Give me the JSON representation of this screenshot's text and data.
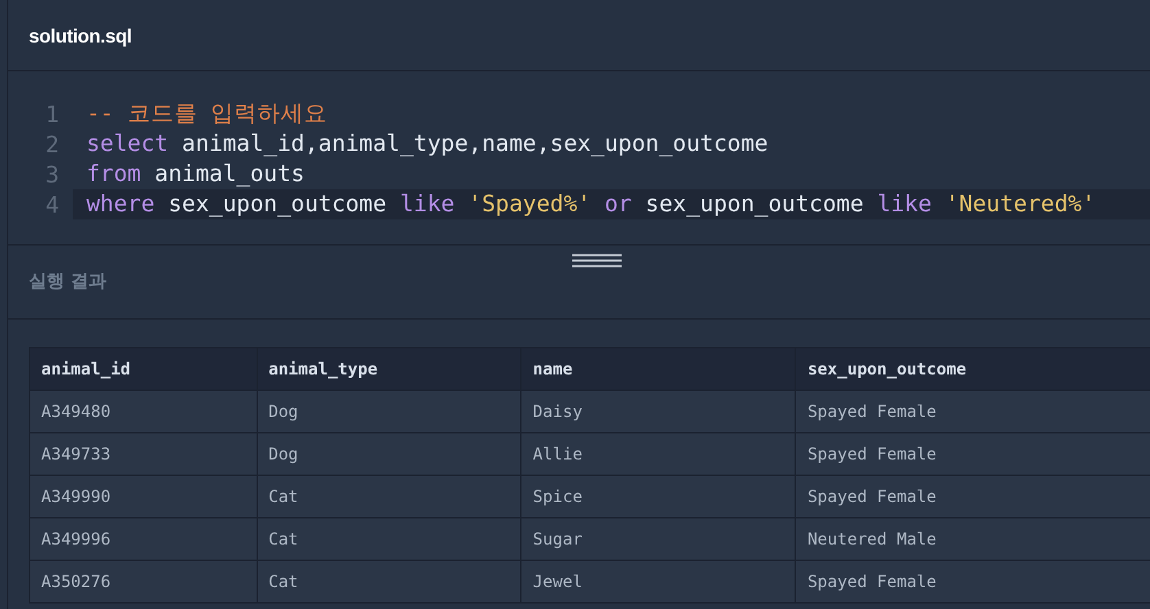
{
  "editor": {
    "file_name": "solution.sql",
    "lines": [
      {
        "number": "1",
        "active": false,
        "tokens": [
          {
            "kind": "comment",
            "text": "-- 코드를 입력하세요"
          }
        ]
      },
      {
        "number": "2",
        "active": false,
        "tokens": [
          {
            "kind": "keyword",
            "text": "select"
          },
          {
            "kind": "plain",
            "text": " animal_id,animal_type,name,sex_upon_outcome"
          }
        ]
      },
      {
        "number": "3",
        "active": false,
        "tokens": [
          {
            "kind": "keyword",
            "text": "from"
          },
          {
            "kind": "plain",
            "text": " animal_outs"
          }
        ]
      },
      {
        "number": "4",
        "active": true,
        "tokens": [
          {
            "kind": "keyword",
            "text": "where"
          },
          {
            "kind": "plain",
            "text": " sex_upon_outcome "
          },
          {
            "kind": "keyword",
            "text": "like "
          },
          {
            "kind": "string",
            "text": "'Spayed%' "
          },
          {
            "kind": "keyword",
            "text": "or"
          },
          {
            "kind": "plain",
            "text": " sex_upon_outcome "
          },
          {
            "kind": "keyword",
            "text": "like "
          },
          {
            "kind": "string",
            "text": "'Neutered%'"
          }
        ]
      }
    ]
  },
  "result": {
    "title": "실행 결과",
    "table": {
      "columns": [
        "animal_id",
        "animal_type",
        "name",
        "sex_upon_outcome"
      ],
      "rows": [
        [
          "A349480",
          "Dog",
          "Daisy",
          "Spayed Female"
        ],
        [
          "A349733",
          "Dog",
          "Allie",
          "Spayed Female"
        ],
        [
          "A349990",
          "Cat",
          "Spice",
          "Spayed Female"
        ],
        [
          "A349996",
          "Cat",
          "Sugar",
          "Neutered Male"
        ],
        [
          "A350276",
          "Cat",
          "Jewel",
          "Spayed Female"
        ]
      ]
    }
  }
}
